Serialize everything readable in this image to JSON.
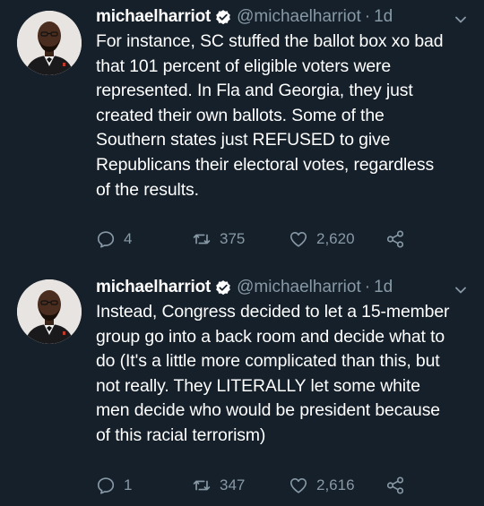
{
  "tweets": [
    {
      "author_name": "michaelharriot",
      "handle": "@michaelharriot",
      "separator": "·",
      "time": "1d",
      "text_lines": [
        "For instance, SC stuffed the ballot box xo bad",
        "that 101 percent of eligible voters were",
        "represented. In Fla and Georgia, they just",
        "created their own ballots. Some of the",
        "Southern states just REFUSED to give",
        "Republicans their electoral votes, regardless",
        "of the results."
      ],
      "replies": "4",
      "retweets": "375",
      "likes": "2,620"
    },
    {
      "author_name": "michaelharriot",
      "handle": "@michaelharriot",
      "separator": "·",
      "time": "1d",
      "text_lines": [
        "Instead, Congress decided to let a 15-member",
        "group go into a back room and decide what to",
        "do (It's a little more complicated than this, but",
        "not really. They LITERALLY let some white",
        "men decide who would be president because",
        "of this racial terrorism)"
      ],
      "replies": "1",
      "retweets": "347",
      "likes": "2,616"
    }
  ],
  "icons": {
    "verified": "verified-badge-icon",
    "caret": "chevron-down-icon",
    "reply": "reply-bubble-icon",
    "retweet": "retweet-icon",
    "like": "heart-icon",
    "share": "share-icon"
  },
  "colors": {
    "background": "#15202b",
    "text_primary": "#ffffff",
    "text_secondary": "#8899a6"
  }
}
